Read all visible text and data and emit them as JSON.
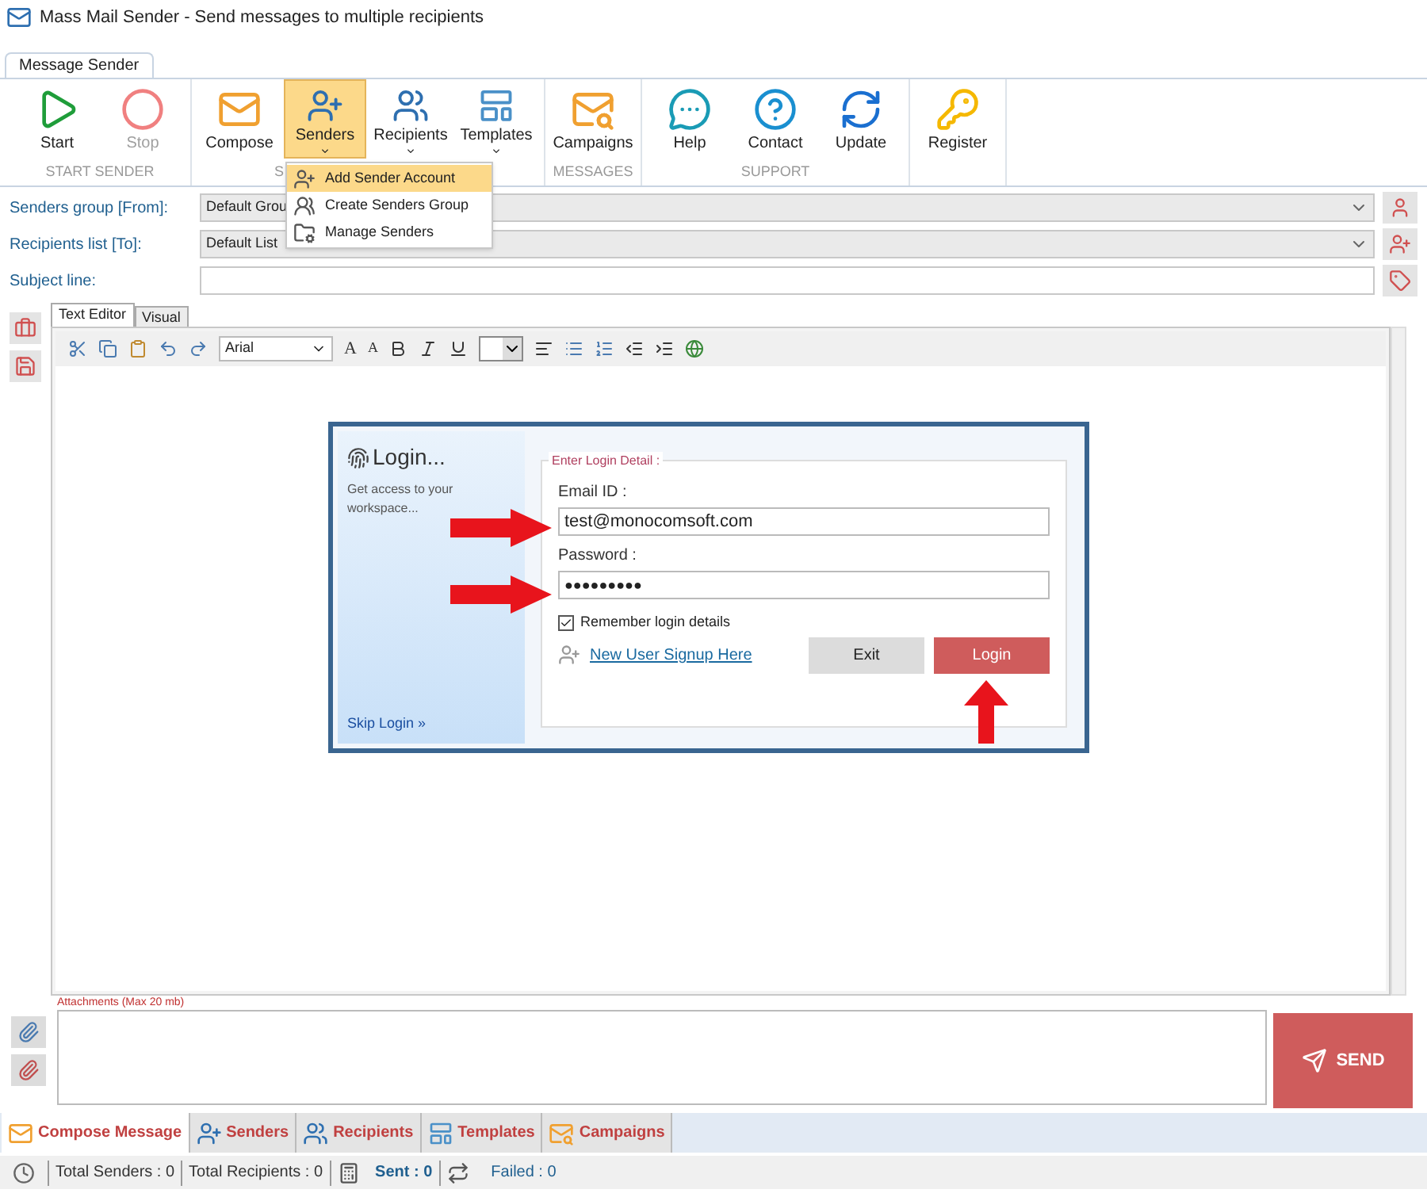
{
  "window": {
    "title": "Mass Mail Sender - Send messages to multiple recipients"
  },
  "ribbon_tab": {
    "label": "Message Sender",
    "selected": true
  },
  "ribbon_groups": [
    {
      "label": "START SENDER",
      "buttons": [
        {
          "label": "Start",
          "kind": "start",
          "disabled": false,
          "dropdown": false,
          "selected": false
        },
        {
          "label": "Stop",
          "kind": "stop",
          "disabled": true,
          "dropdown": false,
          "selected": false
        }
      ]
    },
    {
      "label": "S",
      "buttons": [
        {
          "label": "Compose",
          "kind": "compose",
          "disabled": false,
          "dropdown": false,
          "selected": false
        },
        {
          "label": "Senders",
          "kind": "senders",
          "disabled": false,
          "dropdown": true,
          "selected": true
        },
        {
          "label": "Recipients",
          "kind": "recipients",
          "disabled": false,
          "dropdown": true,
          "selected": false
        },
        {
          "label": "Templates",
          "kind": "templates",
          "disabled": false,
          "dropdown": true,
          "selected": false
        }
      ]
    },
    {
      "label": "MESSAGES",
      "buttons": [
        {
          "label": "Campaigns",
          "kind": "campaigns",
          "disabled": false,
          "dropdown": false,
          "selected": false
        }
      ]
    },
    {
      "label": "SUPPORT",
      "buttons": [
        {
          "label": "Help",
          "kind": "help",
          "disabled": false,
          "dropdown": false,
          "selected": false
        },
        {
          "label": "Contact",
          "kind": "contact",
          "disabled": false,
          "dropdown": false,
          "selected": false
        },
        {
          "label": "Update",
          "kind": "update",
          "disabled": false,
          "dropdown": false,
          "selected": false
        }
      ]
    },
    {
      "buttons": [
        {
          "label": "Register",
          "kind": "register",
          "disabled": false,
          "dropdown": false,
          "selected": false
        }
      ]
    }
  ],
  "dropdown_menu": [
    {
      "label": "Add Sender Account",
      "kind": "add",
      "selected": true
    },
    {
      "label": "Create Senders Group",
      "kind": "group",
      "selected": false
    },
    {
      "label": "Manage Senders",
      "kind": "manage",
      "selected": false
    }
  ],
  "form": [
    {
      "label": "Senders group [From]:",
      "value": "Default Grou",
      "kind": "dropdown"
    },
    {
      "label": "Recipients list [To]:",
      "value": "Default List",
      "kind": "dropdown"
    },
    {
      "label": "Subject line:",
      "kind": "text"
    }
  ],
  "editor_tabs": [
    {
      "label": "Text Editor",
      "selected": true
    },
    {
      "label": "Visual",
      "selected": false
    }
  ],
  "toolbar": {
    "font": "Arial",
    "grow_font": "A",
    "shrink_font": "A"
  },
  "login": {
    "title": "Login...",
    "subtitle": "Get access to your workspace...",
    "skip": "Skip Login »",
    "legend": "Enter Login Detail :",
    "email_label": "Email ID :",
    "email": "test@monocomsoft.com",
    "password_label": "Password :",
    "password": "●●●●●●●●●",
    "remember": {
      "label": "Remember login details",
      "checked": true
    },
    "signup": "New User Signup Here",
    "exit": "Exit",
    "submit": "Login"
  },
  "attachments": {
    "label": "Attachments (Max 20 mb)"
  },
  "send": "SEND",
  "bottom_tabs": [
    {
      "label": "Compose Message",
      "kind": "compose",
      "selected": true
    },
    {
      "label": "Senders",
      "kind": "senders",
      "selected": false
    },
    {
      "label": "Recipients",
      "kind": "recipients",
      "selected": false
    },
    {
      "label": "Templates",
      "kind": "templates",
      "selected": false
    },
    {
      "label": "Campaigns",
      "kind": "campaigns",
      "selected": false
    }
  ],
  "status_bar": [
    {
      "text": "Total Senders : 0",
      "kind": "plain"
    },
    {
      "text": "Total Recipients : 0",
      "kind": "plain"
    },
    {
      "text": "Sent : 0",
      "kind": "sent"
    },
    {
      "text": "Failed : 0",
      "kind": "failed"
    }
  ]
}
